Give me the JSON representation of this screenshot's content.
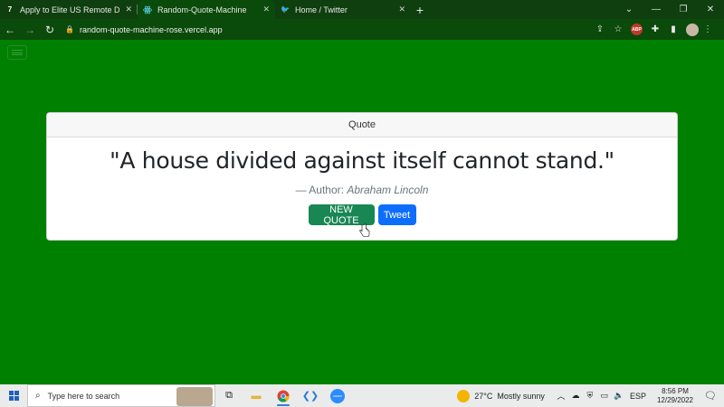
{
  "browser": {
    "tabs": [
      {
        "title": "Apply to Elite US Remote Develo",
        "favicon": "turing-icon",
        "active": false
      },
      {
        "title": "Random-Quote-Machine",
        "favicon": "react-icon",
        "active": true
      },
      {
        "title": "Home / Twitter",
        "favicon": "twitter-icon",
        "active": false
      }
    ],
    "new_tab_label": "+",
    "url": "random-quote-machine-rose.vercel.app",
    "extension_badge": "ABP"
  },
  "page": {
    "background_color": "#008000",
    "card": {
      "header": "Quote",
      "quote_text": "\"A house divided against itself cannot stand.\"",
      "author_prefix": "— Author: ",
      "author_name": "Abraham Lincoln",
      "buttons": {
        "new_quote": "NEW QUOTE",
        "tweet": "Tweet"
      }
    }
  },
  "taskbar": {
    "search_placeholder": "Type here to search",
    "weather": {
      "temp": "27°C",
      "condition": "Mostly sunny"
    },
    "language": "ESP",
    "time": "8:56 PM",
    "date": "12/29/2022",
    "zoom_label": "zoom"
  }
}
